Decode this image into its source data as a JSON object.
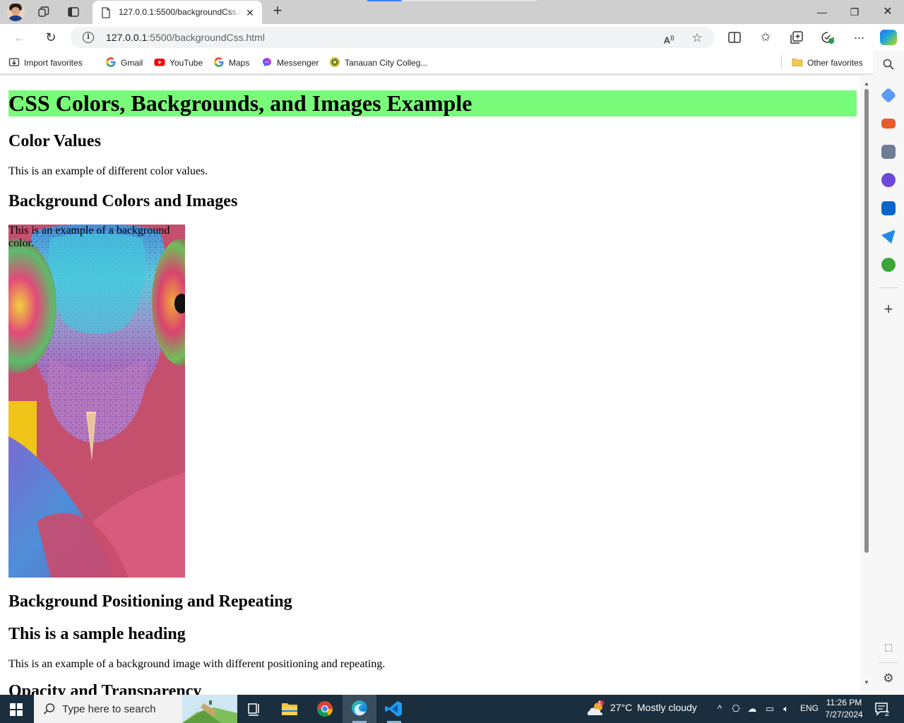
{
  "browser": {
    "tab_title": "127.0.0.1:5500/backgroundCss.html",
    "url_host": "127.0.0.1",
    "url_rest": ":5500/backgroundCss.html"
  },
  "favorites": {
    "import": "Import favorites",
    "gmail": "Gmail",
    "youtube": "YouTube",
    "maps": "Maps",
    "messenger": "Messenger",
    "college": "Tanauan City Colleg...",
    "other": "Other favorites"
  },
  "page": {
    "h1": "CSS Colors, Backgrounds, and Images Example",
    "color_values_heading": "Color Values",
    "color_values_text": "This is an example of different color values.",
    "bg_heading": "Background Colors and Images",
    "bg_text": "This is an example of a background color.",
    "pos_heading": "Background Positioning and Repeating",
    "sample_heading": "This is a sample heading",
    "pos_text": "This is an example of a background image with different positioning and repeating.",
    "cut_heading": "Opacity and Transparency"
  },
  "taskbar": {
    "search_placeholder": "Type here to search",
    "weather_temp": "27°C",
    "weather_desc": "Mostly cloudy",
    "weather_badge": "1",
    "lang": "ENG",
    "time": "11:26 PM",
    "date": "7/27/2024",
    "notif_count": "2"
  },
  "colors": {
    "heading_bg": "#79fb7a",
    "tab_active": "#ffffff",
    "taskbar": "#1a2e3d"
  }
}
